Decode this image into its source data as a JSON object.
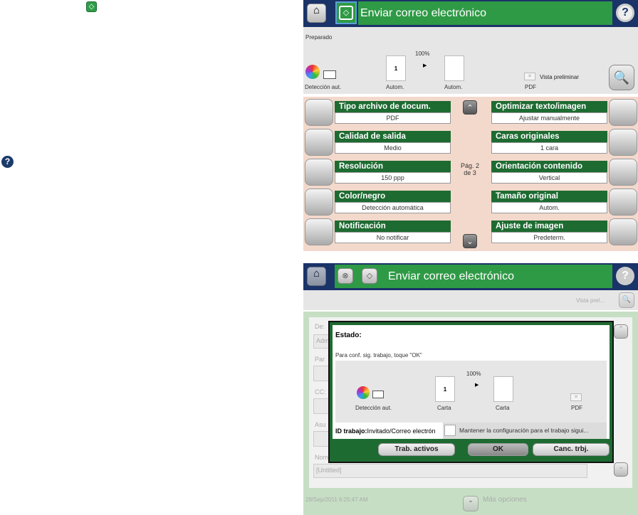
{
  "doc": {
    "start_icon": "start-icon",
    "help_icon": "help-icon"
  },
  "top": {
    "title": "Enviar correo electrónico",
    "status": "Preparado",
    "scale": "100%",
    "color_label": "Detección aut.",
    "orig_label": "Autom.",
    "copy_label": "Autom.",
    "page_number": "1",
    "file_label": "PDF",
    "preview_label": "Vista preliminar",
    "page_indicator": "Pág. 2\nde 3",
    "options_left": [
      {
        "title": "Tipo archivo de docum.",
        "value": "PDF"
      },
      {
        "title": "Calidad de salida",
        "value": "Medio"
      },
      {
        "title": "Resolución",
        "value": "150 ppp"
      },
      {
        "title": "Color/negro",
        "value": "Detección automática"
      },
      {
        "title": "Notificación",
        "value": "No notificar"
      }
    ],
    "options_right": [
      {
        "title": "Optimizar texto/imagen",
        "value": "Ajustar manualmente"
      },
      {
        "title": "Caras originales",
        "value": "1 cara"
      },
      {
        "title": "Orientación contenido",
        "value": "Vertical"
      },
      {
        "title": "Tamaño original",
        "value": "Autom."
      },
      {
        "title": "Ajuste de imagen",
        "value": "Predeterm."
      }
    ]
  },
  "bottom": {
    "title": "Enviar correo electrónico",
    "preview_label": "Vista prel...",
    "fields": {
      "from": "De:",
      "from_value": "Adm",
      "to": "Par",
      "cc": "CC:",
      "subject": "Asu",
      "name": "Nom",
      "name_value": "[Untitled]"
    },
    "timestamp": "28/Sep/2011 6:25:47 AM",
    "more_options": "Más opciones",
    "dialog": {
      "heading": "Estado:",
      "message": "Para conf. sig. trabajo, toque \"OK\"",
      "scale": "100%",
      "page_number": "1",
      "color_label": "Detección aut.",
      "orig_label": "Carta",
      "copy_label": "Carta",
      "file_label": "PDF",
      "job_id_label": "ID trabajo:",
      "job_id_value": "Invitado/Correo electrón",
      "keep_settings": "Mantener la configuración para el trabajo sigui...",
      "keep_checked": false,
      "buttons": {
        "active": "Trab. activos",
        "ok": "OK",
        "cancel": "Canc. trbj."
      }
    }
  }
}
